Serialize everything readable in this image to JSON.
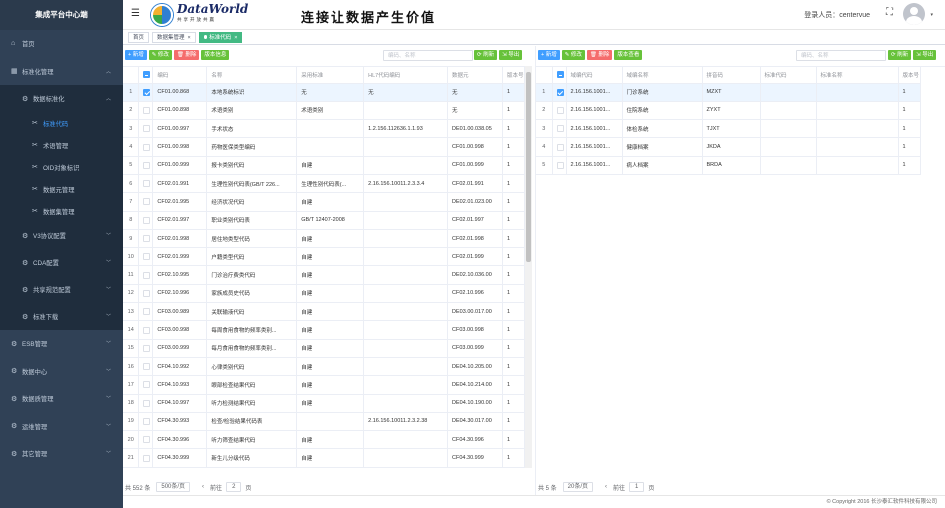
{
  "sidebar": {
    "title": "集成平台中心端",
    "items": [
      {
        "label": "首页",
        "icon": "home-icon",
        "glyph": "⌂"
      },
      {
        "label": "标准化管理",
        "icon": "menu-icon",
        "glyph": "▦"
      }
    ],
    "sub": {
      "label": "数据标准化",
      "icon": "gear-icon",
      "glyph": "⚙"
    },
    "sub3": [
      {
        "label": "标准代码",
        "active": true
      },
      {
        "label": "术语管理"
      },
      {
        "label": "OID对象标识"
      },
      {
        "label": "数据元管理"
      },
      {
        "label": "数据集管理"
      }
    ],
    "sub2": [
      {
        "label": "V3协议配置",
        "glyph": "⚙"
      },
      {
        "label": "CDA配置",
        "glyph": "⚙"
      },
      {
        "label": "共享规范配置",
        "glyph": "⚙"
      },
      {
        "label": "标准下载",
        "glyph": "⚙"
      }
    ],
    "bottom": [
      {
        "label": "ESB管理",
        "glyph": "⚙"
      },
      {
        "label": "数据中心",
        "glyph": "⚙"
      },
      {
        "label": "数据质管理",
        "glyph": "⚙"
      },
      {
        "label": "运维管理",
        "glyph": "⚙"
      },
      {
        "label": "其它管理",
        "glyph": "⚙"
      }
    ]
  },
  "header": {
    "logo_text": "DataWorld",
    "logo_sub": "共享开放共赢",
    "slogan": "连接让数据产生价值",
    "login_text": "登录人员：centervue"
  },
  "tags": [
    {
      "label": "首页"
    },
    {
      "label": "数据集管理",
      "close": "×"
    },
    {
      "label": "标准代码",
      "close": "×",
      "active": true
    }
  ],
  "left": {
    "buttons": {
      "add": "+ 新增",
      "edit": "✎ 修改",
      "del": "🗑 删除",
      "version": "版本信息",
      "reset": "⟳ 刷新",
      "export": "⇲ 导出"
    },
    "search_placeholder": "编码、名称",
    "columns": [
      "",
      "",
      "编码",
      "名称",
      "采用标准",
      "HL7代码编码",
      "数据元",
      "版本号"
    ],
    "rows": [
      [
        "1",
        "CF01.00.868",
        "本地系统标识",
        "无",
        "无",
        "无",
        "1"
      ],
      [
        "2",
        "CF01.00.898",
        "术语类别",
        "术语类别",
        "",
        "无",
        "1"
      ],
      [
        "3",
        "CF01.00.997",
        "手术状态",
        "",
        "1.2.156.112636.1.1.93",
        "DE01.00.038.05",
        "1"
      ],
      [
        "4",
        "CF01.00.998",
        "药物医保类型编码",
        "",
        "",
        "CF01.00.998",
        "1"
      ],
      [
        "5",
        "CF01.00.999",
        "报卡类别代码",
        "自建",
        "",
        "CF01.00.999",
        "1"
      ],
      [
        "6",
        "CF02.01.991",
        "生理性别代码表(GB/T 226...",
        "生理性别代码表(...",
        "2.16.156.10011.2.3.3.4",
        "CF02.01.991",
        "1"
      ],
      [
        "7",
        "CF02.01.995",
        "经济状况代码",
        "自建",
        "",
        "DE02.01.023.00",
        "1"
      ],
      [
        "8",
        "CF02.01.997",
        "职业类别代码表",
        "GB/T 12407-2008",
        "",
        "CF02.01.997",
        "1"
      ],
      [
        "9",
        "CF02.01.998",
        "居住地类型代码",
        "自建",
        "",
        "CF02.01.998",
        "1"
      ],
      [
        "10",
        "CF02.01.999",
        "户籍类型代码",
        "自建",
        "",
        "CF02.01.999",
        "1"
      ],
      [
        "11",
        "CF02.10.995",
        "门诊治疗费类代码",
        "自建",
        "",
        "DE02.10.036.00",
        "1"
      ],
      [
        "12",
        "CF02.10.996",
        "家族成员史代码",
        "自建",
        "",
        "CF02.10.996",
        "1"
      ],
      [
        "13",
        "CF03.00.989",
        "关联输液代码",
        "自建",
        "",
        "DE03.00.017.00",
        "1"
      ],
      [
        "14",
        "CF03.00.998",
        "每周食用食物的频率类别...",
        "自建",
        "",
        "CF03.00.998",
        "1"
      ],
      [
        "15",
        "CF03.00.999",
        "每月食用食物的频率类别...",
        "自建",
        "",
        "CF03.00.999",
        "1"
      ],
      [
        "16",
        "CF04.10.992",
        "心律类别代码",
        "自建",
        "",
        "DE04.10.205.00",
        "1"
      ],
      [
        "17",
        "CF04.10.993",
        "眼部检查结果代码",
        "自建",
        "",
        "DE04.10.214.00",
        "1"
      ],
      [
        "18",
        "CF04.10.997",
        "听力检测结果代码",
        "自建",
        "",
        "DE04.10.190.00",
        "1"
      ],
      [
        "19",
        "CF04.30.993",
        "检查/检验结果代码表",
        "",
        "2.16.156.10011.2.3.2.38",
        "DE04.30.017.00",
        "1"
      ],
      [
        "20",
        "CF04.30.996",
        "听力筛查结果代码",
        "自建",
        "",
        "CF04.30.996",
        "1"
      ],
      [
        "21",
        "CF04.30.999",
        "新生儿分级代码",
        "自建",
        "",
        "CF04.30.999",
        "1"
      ],
      [
        "22",
        "CF04.41.999",
        "国际卫生机构病种分类",
        "自建",
        "2.16.156.10011.2.3.2.62",
        "CF04.41.999",
        "1"
      ]
    ],
    "pager": {
      "total": "共 552 条",
      "size": "500条/页",
      "prev": "‹",
      "goto": "前往",
      "page": "2",
      "unit": "页"
    }
  },
  "right": {
    "buttons": {
      "add": "+ 新增",
      "edit": "✎ 修改",
      "del": "🗑 删除",
      "version": "版本查看",
      "reset": "⟳ 刷新",
      "export": "⇲ 导出"
    },
    "search_placeholder": "编码、名称",
    "columns": [
      "",
      "",
      "域编代码",
      "域编名称",
      "拼音码",
      "标准代码",
      "标准名称",
      "版本号"
    ],
    "rows": [
      [
        "1",
        "2.16.156.1001...",
        "门诊系统",
        "MZXT",
        "",
        "",
        "1"
      ],
      [
        "2",
        "2.16.156.1001...",
        "住院系统",
        "ZYXT",
        "",
        "",
        "1"
      ],
      [
        "3",
        "2.16.156.1001...",
        "体检系统",
        "TJXT",
        "",
        "",
        "1"
      ],
      [
        "4",
        "2.16.156.1001...",
        "健康档案",
        "JKDA",
        "",
        "",
        "1"
      ],
      [
        "5",
        "2.16.156.1001...",
        "病人档案",
        "BRDA",
        "",
        "",
        "1"
      ]
    ],
    "pager": {
      "total": "共 5 条",
      "size": "20条/页",
      "prev": "‹",
      "goto": "前往",
      "page": "1",
      "unit": "页"
    }
  },
  "footer": "© Copyright 2016 长沙泰汇软件科技有限公司"
}
